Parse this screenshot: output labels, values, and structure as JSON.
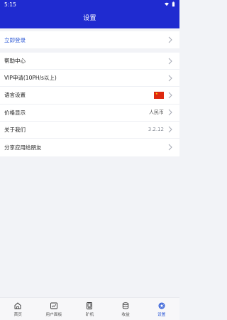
{
  "status": {
    "time": "5:15"
  },
  "header": {
    "title": "设置"
  },
  "login": {
    "label": "立即登录"
  },
  "menu": {
    "items": [
      {
        "label": "帮助中心",
        "value": ""
      },
      {
        "label": "VIP申请(10PH/s以上)",
        "value": ""
      },
      {
        "label": "语言设置",
        "value": ""
      },
      {
        "label": "价格显示",
        "value": "人民币"
      },
      {
        "label": "关于我们",
        "value": "3.2.12"
      },
      {
        "label": "分享应用给朋友",
        "value": ""
      }
    ]
  },
  "tabs": [
    {
      "label": "首页",
      "icon": "home-icon"
    },
    {
      "label": "用户面板",
      "icon": "dashboard-icon"
    },
    {
      "label": "矿机",
      "icon": "miner-icon"
    },
    {
      "label": "收益",
      "icon": "coin-stack-icon"
    },
    {
      "label": "设置",
      "icon": "settings-icon"
    }
  ],
  "colors": {
    "header": "#1f2bd0",
    "accent": "#2f5bd6",
    "flag_red": "#de2910"
  }
}
